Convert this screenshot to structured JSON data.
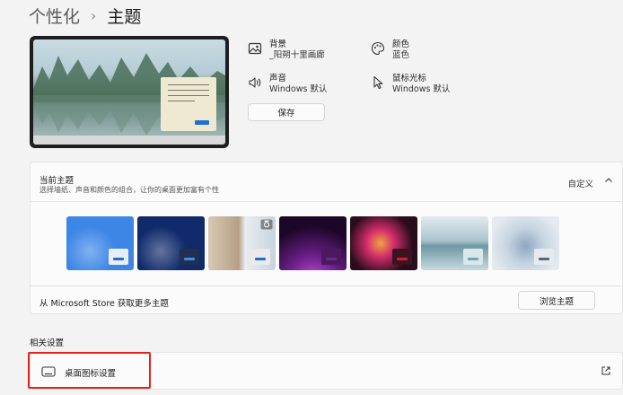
{
  "breadcrumb": {
    "parent": "个性化",
    "separator": "›",
    "current": "主题"
  },
  "theme_props": {
    "background": {
      "label": "背景",
      "value": "_阳朔十里画廊",
      "icon": "image-icon"
    },
    "color": {
      "label": "颜色",
      "value": "蓝色",
      "icon": "palette-icon"
    },
    "sound": {
      "label": "声音",
      "value": "Windows 默认",
      "icon": "speaker-icon"
    },
    "cursor": {
      "label": "鼠标光标",
      "value": "Windows 默认",
      "icon": "cursor-icon"
    }
  },
  "save_label": "保存",
  "current_theme": {
    "title": "当前主题",
    "subtitle": "选择墙纸、声音和颜色的组合，让你的桌面更加富有个性",
    "custom_label": "自定义",
    "themes": [
      {
        "name": "windows-light",
        "bg": "#3d86e6",
        "mini": "#e9eef5",
        "bar": "#1e6fd0"
      },
      {
        "name": "windows-dark",
        "bg": "#102a6b",
        "mini": "#20304e",
        "bar": "#3b8df0"
      },
      {
        "name": "custom-photo",
        "bg": "#c9b7a0",
        "mini": "#eaeaea",
        "bar": "#1e6fd0"
      },
      {
        "name": "glow",
        "bg": "#2a0a3a",
        "mini": "#4b1a5e",
        "bar": "#6b2a8a"
      },
      {
        "name": "captured-motion",
        "bg": "#1a0d12",
        "mini": "#3a1420",
        "bar": "#d41c2a"
      },
      {
        "name": "sunrise",
        "bg": "#a9c4cf",
        "mini": "#d9e6ea",
        "bar": "#6aa7b8"
      },
      {
        "name": "flow",
        "bg": "#b9c9d8",
        "mini": "#e5eaef",
        "bar": "#5a6772"
      }
    ]
  },
  "store": {
    "text": "从 Microsoft Store 获取更多主题",
    "browse_label": "浏览主题"
  },
  "related": {
    "title": "相关设置",
    "desktop_icons_label": "桌面图标设置"
  }
}
